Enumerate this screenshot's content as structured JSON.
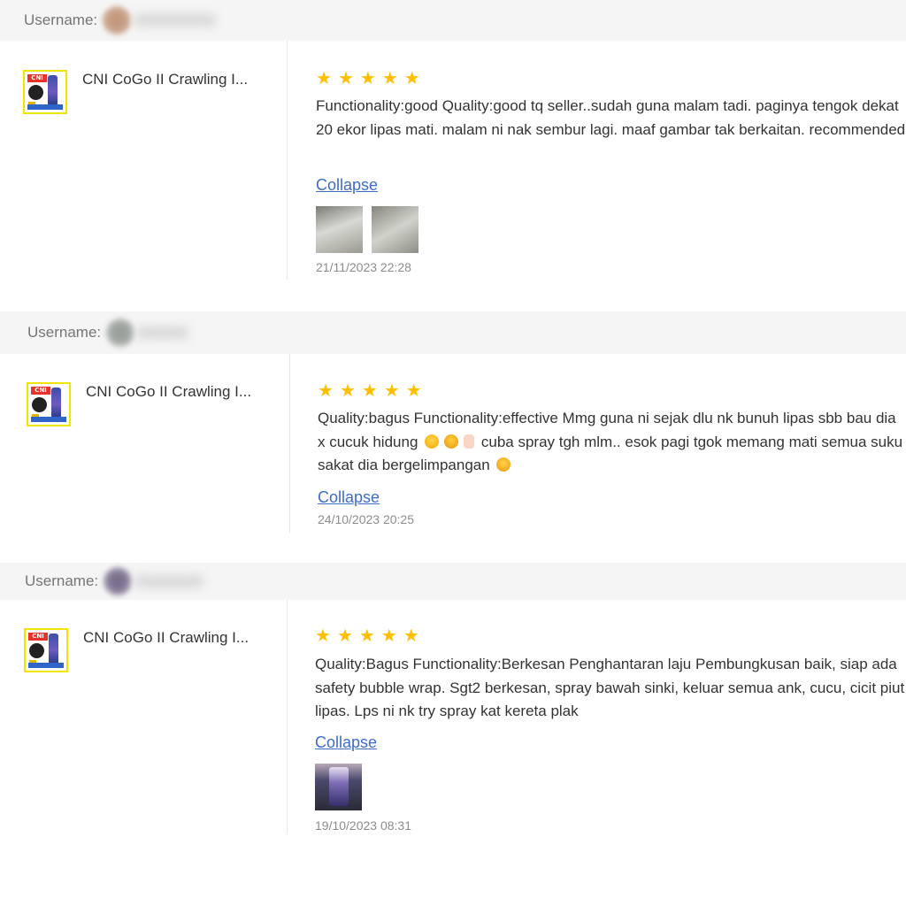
{
  "reviews": [
    {
      "username_label": "Username:",
      "product_name": "CNI CoGo II Crawling I...",
      "rating": 5,
      "stars": "★★★★★",
      "text": "Functionality:good Quality:good tq seller..sudah guna malam tadi. paginya tengok dekat 20 ekor lipas mati. malam ni nak sembur lagi. maaf gambar tak berkaitan. recommended",
      "collapse_label": "Collapse",
      "photos": [
        "review-photo-1",
        "review-photo-2"
      ],
      "timestamp": "21/11/2023 22:28"
    },
    {
      "username_label": "Username:",
      "product_name": "CNI CoGo II Crawling I...",
      "rating": 5,
      "stars": "★★★★★",
      "text_parts": [
        "Quality:bagus Functionality:effective Mmg guna ni sejak dlu nk bunuh lipas sbb bau dia x cucuk hidung",
        "cuba spray tgh mlm.. esok pagi tgok memang mati semua suku sakat dia bergelimpangan"
      ],
      "collapse_label": "Collapse",
      "timestamp": "24/10/2023 20:25"
    },
    {
      "username_label": "Username:",
      "product_name": "CNI CoGo II Crawling I...",
      "rating": 5,
      "stars": "★★★★★",
      "text": "Quality:Bagus Functionality:Berkesan Penghantaran laju Pembungkusan baik, siap ada safety bubble wrap. Sgt2 berkesan, spray bawah sinki, keluar semua ank, cucu, cicit piut lipas. Lps ni nk try spray kat kereta plak",
      "collapse_label": "Collapse",
      "photos": [
        "review-photo-3"
      ],
      "timestamp": "19/10/2023 08:31"
    }
  ],
  "colors": {
    "star": "#ffbf00",
    "link": "#3d6dc4",
    "header_bg": "#f5f5f5",
    "thumb_border": "#f2e600"
  },
  "icons": {
    "star": "star-icon",
    "emoji": [
      "smiling-face-with-hearts-icon",
      "grinning-face-icon",
      "thumbs-up-icon",
      "grimacing-face-icon"
    ]
  },
  "thumb_logo_text": "CNI"
}
